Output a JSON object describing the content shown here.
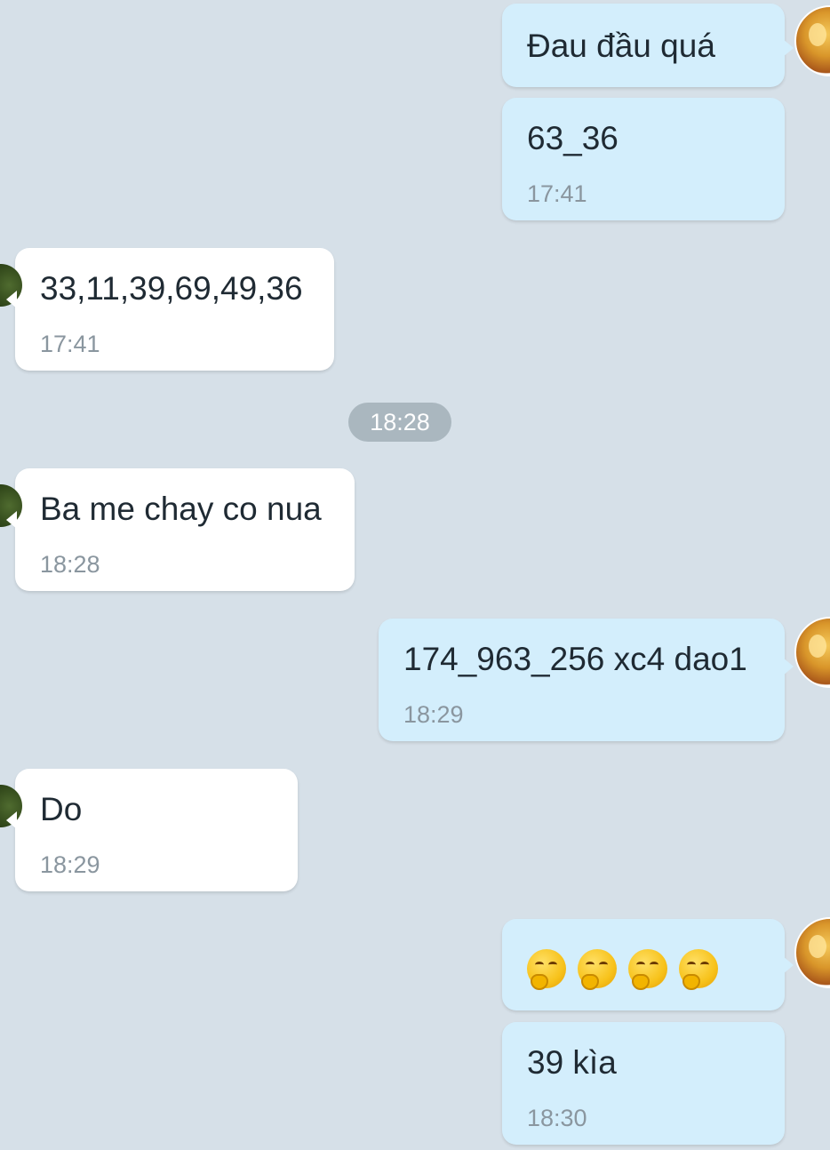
{
  "messages": {
    "m1": {
      "text": "Đau đầu quá"
    },
    "m2": {
      "text": "63_36",
      "time": "17:41"
    },
    "m3": {
      "text": "33,11,39,69,49,36",
      "time": "17:41"
    },
    "m4": {
      "text": "Ba me chay co nua",
      "time": "18:28"
    },
    "m5": {
      "text": "174_963_256 xc4 dao1",
      "time": "18:29"
    },
    "m6": {
      "text": "Do",
      "time": "18:29"
    },
    "m7": {
      "emoji": [
        "hand-over-mouth-emoji",
        "hand-over-mouth-emoji",
        "hand-over-mouth-emoji",
        "hand-over-mouth-emoji"
      ]
    },
    "m8": {
      "text": "39 kìa",
      "time": "18:30"
    }
  },
  "time_separator": "18:28",
  "colors": {
    "background": "#d6e0e8",
    "outgoing_bubble": "#d3eefc",
    "incoming_bubble": "#ffffff",
    "time_pill": "#aab7bf"
  }
}
